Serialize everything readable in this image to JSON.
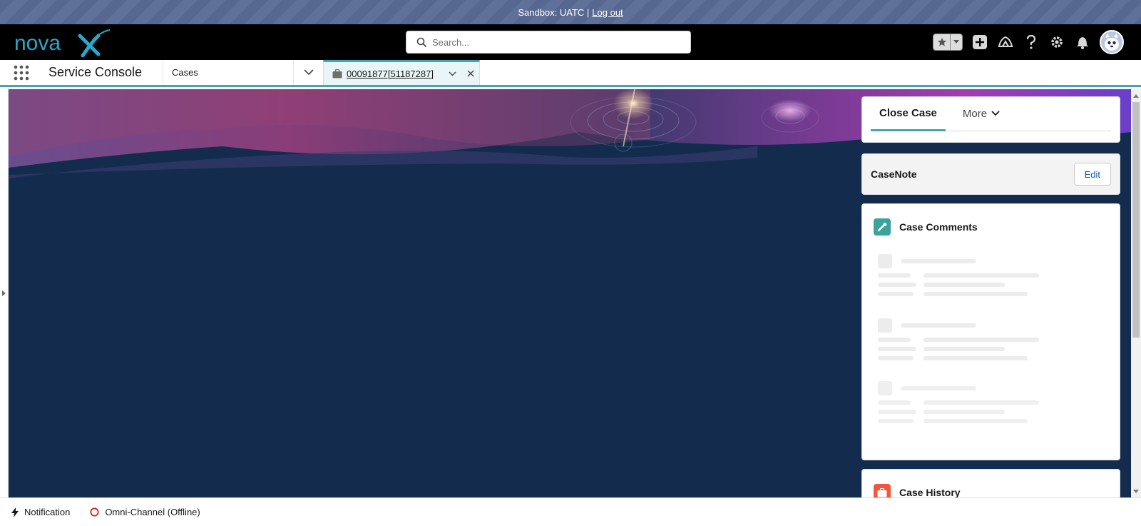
{
  "banner": {
    "text": "Sandbox: UATC |",
    "logout": "Log out"
  },
  "header": {
    "logo_text": "nova",
    "logo_mark": "X",
    "search_placeholder": "Search..."
  },
  "nav": {
    "app_name": "Service Console",
    "object_tab": "Cases",
    "record_tab": "00091877[51187287]"
  },
  "sidebar": {
    "tabs": [
      {
        "label": "Close Case"
      },
      {
        "label": "More"
      }
    ],
    "casenote": {
      "title": "CaseNote",
      "edit_label": "Edit"
    },
    "comments": {
      "title": "Case Comments"
    },
    "history": {
      "title": "Case History"
    }
  },
  "utility": {
    "notification": "Notification",
    "omni": "Omni-Channel (Offline)"
  },
  "colors": {
    "banner": "#56688f",
    "header_bg": "#000000",
    "accent": "#45a3b8",
    "hero_bg": "#132c4e",
    "comments_icon": "#3ba39b",
    "history_icon": "#f2563c",
    "omni_offline": "#d4281e"
  }
}
